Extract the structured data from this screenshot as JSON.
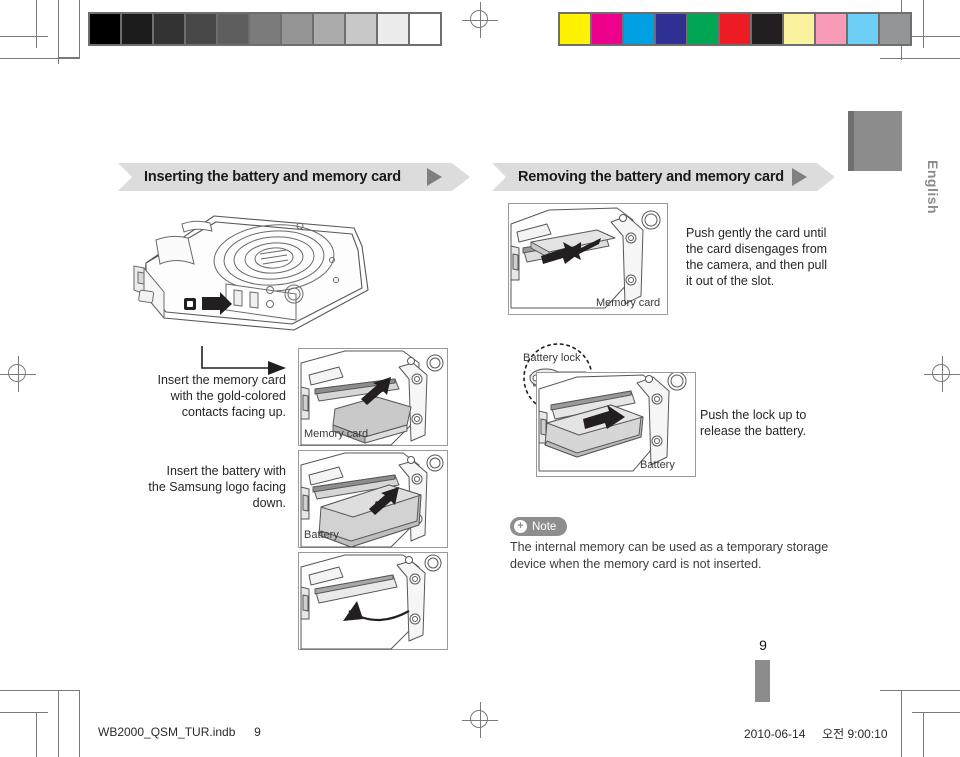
{
  "page": {
    "language_tab": "English",
    "page_number": "9"
  },
  "calibration": {
    "grayscale": [
      "#000000",
      "#1c1c1c",
      "#333333",
      "#474747",
      "#5e5e5e",
      "#7b7b7b",
      "#949494",
      "#ababab",
      "#c8c8c8",
      "#ececec",
      "#ffffff"
    ],
    "colors": [
      "#fff200",
      "#ec008c",
      "#00a0e3",
      "#2e3192",
      "#00a651",
      "#ed1c24",
      "#231f20",
      "#fbf2a0",
      "#f89bb7",
      "#6dcff6",
      "#939598"
    ]
  },
  "sections": [
    {
      "id": "inserting",
      "title": "Inserting the battery and memory card",
      "arrow_icon": "triangle-right-icon"
    },
    {
      "id": "removing",
      "title": "Removing the battery and memory card",
      "arrow_icon": "triangle-right-icon"
    }
  ],
  "left_column": {
    "memory_card_instruction": "Insert the memory card\nwith the gold-colored\ncontacts facing up.",
    "battery_instruction": "Insert the battery with\nthe Samsung logo facing\ndown.",
    "captions": {
      "memory_card": "Memory card",
      "battery": "Battery"
    }
  },
  "right_column": {
    "remove_card_instruction": "Push gently the card until\nthe card disengages from\nthe camera, and then pull\nit out of the slot.",
    "remove_battery_instruction": "Push the lock up to\nrelease the battery.",
    "captions": {
      "memory_card": "Memory card",
      "battery_lock": "Battery lock",
      "battery": "Battery"
    }
  },
  "note": {
    "badge_label": "Note",
    "badge_icon": "plus-circle-icon",
    "text": "The internal memory can be used as a temporary storage device when the memory card is not inserted."
  },
  "footer": {
    "filename": "WB2000_QSM_TUR.indb",
    "page": "9",
    "date": "2010-06-14",
    "time": "오전 9:00:10"
  }
}
